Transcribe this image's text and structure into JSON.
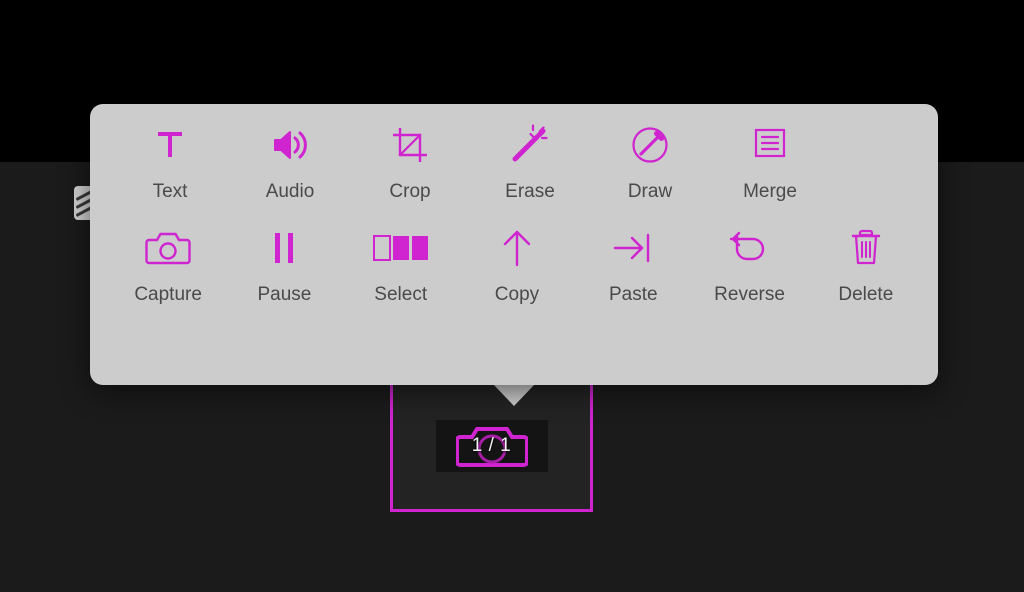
{
  "theme": {
    "accent": "#cf24cf",
    "popover_bg": "#cccccc",
    "label_color": "#4a4a4a",
    "canvas_top": "#000000",
    "canvas_bottom": "#1b1b1b"
  },
  "popover": {
    "name": "editing-tools-popover",
    "rows": [
      {
        "tools": [
          {
            "label": "Text",
            "icon": "text-icon"
          },
          {
            "label": "Audio",
            "icon": "audio-speaker-icon"
          },
          {
            "label": "Crop",
            "icon": "crop-icon"
          },
          {
            "label": "Erase",
            "icon": "magic-wand-erase-icon"
          },
          {
            "label": "Draw",
            "icon": "draw-pencil-circle-icon"
          },
          {
            "label": "Merge",
            "icon": "merge-document-icon"
          }
        ]
      },
      {
        "tools": [
          {
            "label": "Capture",
            "icon": "camera-capture-icon"
          },
          {
            "label": "Pause",
            "icon": "pause-icon"
          },
          {
            "label": "Select",
            "icon": "select-frames-icon"
          },
          {
            "label": "Copy",
            "icon": "arrow-up-copy-icon"
          },
          {
            "label": "Paste",
            "icon": "arrow-right-bar-paste-icon"
          },
          {
            "label": "Reverse",
            "icon": "arrow-undo-reverse-icon"
          },
          {
            "label": "Delete",
            "icon": "trash-delete-icon"
          }
        ]
      }
    ]
  },
  "canvas": {
    "selected_clip": {
      "name": "selected-clip-frame",
      "thumbnail_icon": "camera-icon",
      "count_label": "1 / 1"
    },
    "side_icon": "film-strip-icon"
  }
}
